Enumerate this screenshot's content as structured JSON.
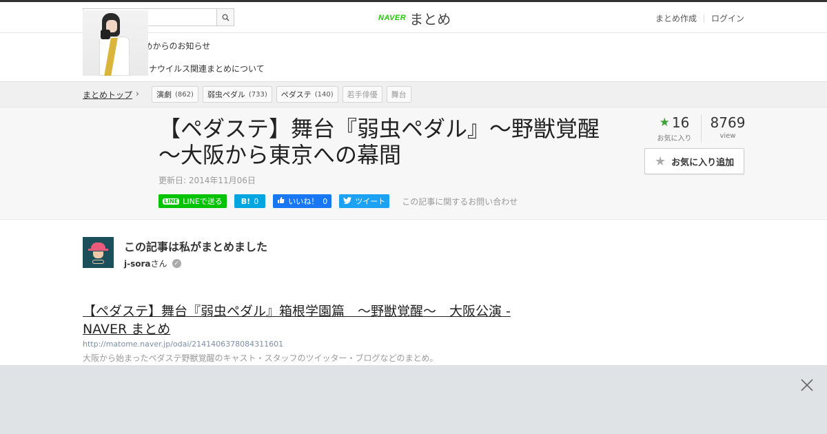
{
  "header": {
    "search_placeholder": "",
    "logo_naver": "NAVER",
    "logo_matome": "まとめ",
    "links": [
      "まとめ作成",
      "ログイン"
    ]
  },
  "notice": {
    "title": "NAVERまとめからのお知らせ",
    "item": "【注意】新型コロナウイルス関連まとめについて"
  },
  "breadcrumb": {
    "top": "まとめトップ",
    "tags": [
      {
        "label": "演劇",
        "count": "(862)"
      },
      {
        "label": "弱虫ペダル",
        "count": "(733)"
      },
      {
        "label": "ペダステ",
        "count": "(140)"
      },
      {
        "label": "若手俳優",
        "count": ""
      },
      {
        "label": "舞台",
        "count": ""
      }
    ]
  },
  "article": {
    "title": "【ペダステ】舞台『弱虫ペダル』～野獣覚醒～大阪から東京への幕間",
    "updated": "更新日: 2014年11月06日",
    "share": {
      "line": "LINEで送る",
      "hatena_icon": "B!",
      "hatena_count": "0",
      "fb_label": "いいね！",
      "fb_count": "0",
      "tweet": "ツイート",
      "inquiry": "この記事に関するお問い合わせ"
    },
    "favorites": "16",
    "favorites_label": "お気に入り",
    "views": "8769",
    "views_label": "view",
    "fav_button": "お気に入り追加"
  },
  "author": {
    "heading": "この記事は私がまとめました",
    "name": "j-sora",
    "suffix": "さん"
  },
  "link_card": {
    "title": "【ペダステ】舞台『弱虫ペダル』箱根学園篇　～野獣覚醒～　大阪公演 - NAVER まとめ",
    "url": "http://matome.naver.jp/odai/2141406378084311601",
    "description": "大阪から始まったペダステ野獣覚醒のキャスト・スタッフのツイッター・ブログなどのまとめ。"
  },
  "colors": {
    "brand_green": "#1ec800",
    "line": "#00c300",
    "hatena": "#00a4de",
    "facebook": "#1877f2",
    "twitter": "#1da1f2",
    "overlay": "#e0e3e6"
  }
}
